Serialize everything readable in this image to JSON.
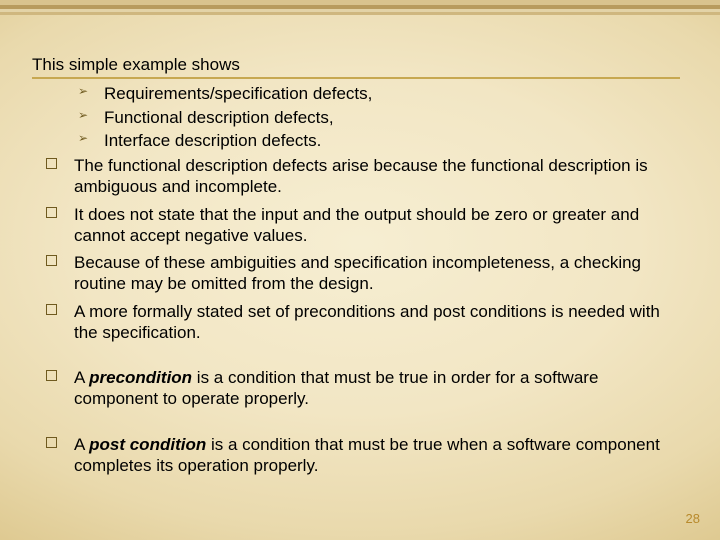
{
  "intro": "This simple example shows",
  "arrows": [
    "Requirements/specification defects,",
    "Functional description defects,",
    "Interface description defects."
  ],
  "boxesA": [
    "The functional description defects arise because the functional description is ambiguous and incomplete.",
    "It does not state that the input and the output should be zero or greater and cannot accept negative values.",
    "Because of these ambiguities and specification incompleteness, a checking routine may be omitted from the design.",
    "A more formally stated set of preconditions and post conditions is needed with the specification."
  ],
  "boxB": {
    "prefix": "A ",
    "term": "precondition",
    "rest": " is a condition that must be true in order for a software component to operate properly."
  },
  "boxC": {
    "prefix": "A ",
    "term": "post condition",
    "rest": " is a condition that must be true when a software component completes its operation properly."
  },
  "page": "28"
}
